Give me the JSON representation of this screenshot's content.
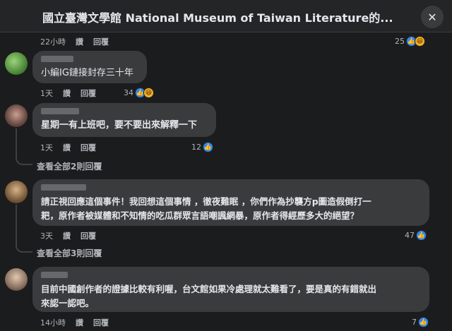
{
  "header": {
    "title": "國立臺灣文學館 National Museum of Taiwan Literature的...",
    "close_icon": "close-icon"
  },
  "top_actions": {
    "time": "22小時",
    "like": "讚",
    "reply": "回覆",
    "reactions": "25"
  },
  "comments": [
    {
      "text": "小編IG鏈接封存三十年",
      "time": "1天",
      "like": "讚",
      "reply": "回覆",
      "reactions": "34"
    },
    {
      "text": "星期一有上班吧，要不要出來解釋一下",
      "time": "1天",
      "like": "讚",
      "reply": "回覆",
      "reactions": "12",
      "view_replies": "查看全部2則回覆"
    },
    {
      "text_lines": [
        "請正視回應這個事件！我回想這個事情 ，徹夜難眠 ，你們作為抄襲方p圖造假倒打一",
        "耙，原作者被媒體和不知情的吃瓜群眾言語嘲諷網暴，原作者得經歷多大的絕望？"
      ],
      "time": "3天",
      "like": "讚",
      "reply": "回覆",
      "reactions": "47",
      "view_replies": "查看全部3則回覆"
    },
    {
      "text_lines": [
        "目前中國創作者的證據比較有利喔，台文館如果冷處理就太難看了，要是真的有錯就出",
        "來認一認吧。"
      ],
      "time": "14小時",
      "like": "讚",
      "reply": "回覆",
      "reactions": "7"
    }
  ],
  "icons": {
    "like": "like-icon",
    "haha": "haha-icon"
  },
  "colors": {
    "background": "#1b1c1d",
    "bubble": "#3a3b3c",
    "like": "#2d88ff",
    "haha": "#f7b125"
  }
}
